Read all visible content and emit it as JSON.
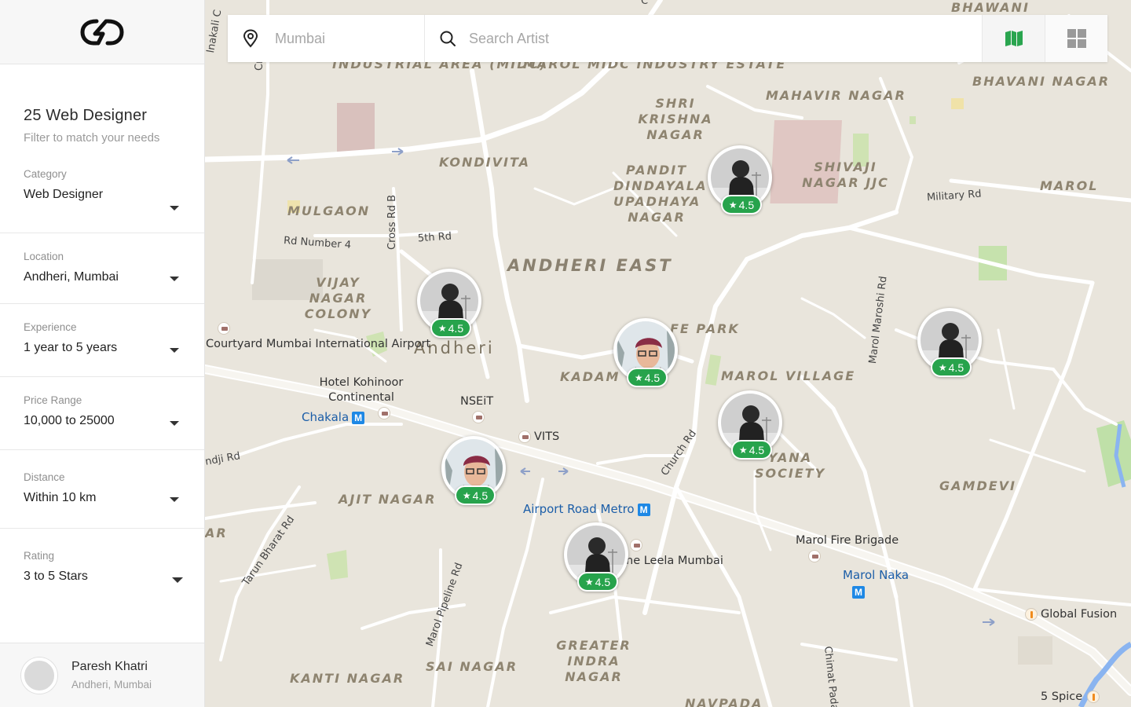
{
  "sidebar": {
    "logo": "logo-icon",
    "heading": {
      "title": "25 Web Designer",
      "subtitle": "Filter to match your needs"
    },
    "filters": [
      {
        "label": "Category",
        "value": "Web Designer"
      },
      {
        "label": "Location",
        "value": "Andheri, Mumbai"
      },
      {
        "label": "Experience",
        "value": "1 year to 5 years"
      },
      {
        "label": "Price Range",
        "value": "10,000 to 25000"
      },
      {
        "label": "Distance",
        "value": "Within 10 km"
      },
      {
        "label": "Rating",
        "value": "3 to 5 Stars"
      }
    ],
    "user": {
      "name": "Paresh Khatri",
      "location": "Andheri, Mumbai"
    }
  },
  "search": {
    "location_placeholder": "Mumbai",
    "artist_placeholder": "Search Artist",
    "view_buttons": [
      "map-view-icon",
      "grid-view-icon"
    ]
  },
  "map": {
    "areas": [
      "INDUSTRIAL AREA (MIDC)",
      "MAROL MIDC INDUSTRY ESTATE",
      "SHRI KRISHNA NAGAR",
      "MAHAVIR NAGAR",
      "BHAVANI NAGAR",
      "BHAWANI",
      "KONDIVITA",
      "PANDIT DINDAYALA UPADHAYA NAGAR",
      "SHIVAJI NAGAR JJC",
      "MAROL",
      "MULGAON",
      "ANDHERI EAST",
      "VIJAY NAGAR COLONY",
      "Andheri",
      "KADAM W",
      "FE PARK",
      "MAROL VILLAGE",
      "YANA SOCIETY",
      "GAMDEVI",
      "AJIT NAGAR",
      "AR",
      "GREATER INDRA NAGAR",
      "SAI NAGAR",
      "KANTI NAGAR",
      "NAVPADA"
    ],
    "places": [
      "Courtyard Mumbai International Airport",
      "Hotel Kohinoor Continental",
      "NSEiT",
      "VITS",
      "Marol Fire Brigade",
      "Global Fusion",
      "5 Spice",
      "he Leela Mumbai"
    ],
    "roads": [
      "Cross",
      "Cross Rd B",
      "5th Rd",
      "Rd Number 4",
      "Military Rd",
      "Marol Maroshi Rd",
      "Church Rd",
      "Tarun Bharat Rd",
      "Marol Pipeline Rd",
      "Chimat Pada",
      "ndji Rd",
      "lnakali C",
      "C"
    ],
    "metro_stations": [
      "Chakala",
      "Airport Road Metro",
      "Marol Naka"
    ],
    "metro_badge": "M"
  },
  "markers": [
    {
      "rating": "4.5",
      "photo": "silhouette"
    },
    {
      "rating": "4.5",
      "photo": "silhouette"
    },
    {
      "rating": "4.5",
      "photo": "woman"
    },
    {
      "rating": "4.5",
      "photo": "silhouette"
    },
    {
      "rating": "4.5",
      "photo": "silhouette"
    },
    {
      "rating": "4.5",
      "photo": "woman"
    },
    {
      "rating": "4.5",
      "photo": "silhouette"
    }
  ],
  "colors": {
    "accent_green": "#27a34c",
    "metro_blue": "#1e88e5",
    "map_bg": "#e9e5dc"
  }
}
